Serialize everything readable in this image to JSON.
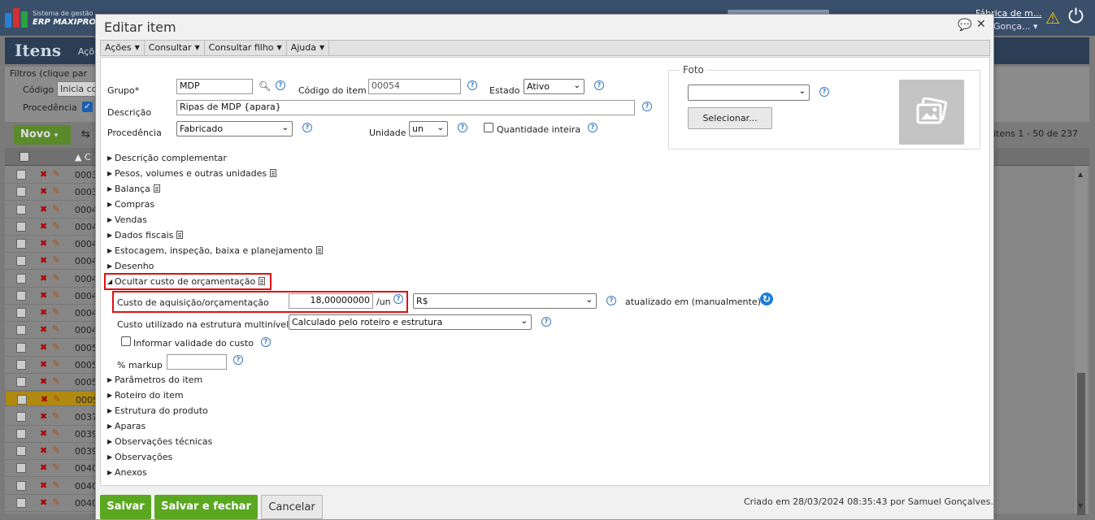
{
  "app": {
    "brand_line1": "Sistema de gestão",
    "brand_line2": "ERP MAXIPROD",
    "company": "Fábrica de m...",
    "user": "Gonça...",
    "page_title": "Itens",
    "page_menu": "Açõ",
    "filters_title": "Filtros (clique par",
    "filter_code_label": "Código",
    "filter_code_value": "Inicia co",
    "filter_origin_label": "Procedência",
    "new_button": "Novo",
    "pager": "itens 1 - 50 de 237",
    "grid_head": "C",
    "rows": [
      "0003",
      "0003",
      "0004",
      "0004",
      "0004",
      "0004",
      "0004",
      "0004",
      "0004",
      "0004",
      "0005",
      "0005",
      "0005",
      "0005",
      "0037",
      "0039",
      "0039",
      "0040",
      "0040",
      "0040"
    ],
    "selected_row": 13
  },
  "modal": {
    "title": "Editar item",
    "menu": [
      "Ações",
      "Consultar",
      "Consultar filho",
      "Ajuda"
    ],
    "form": {
      "grupo_label": "Grupo*",
      "grupo_value": "MDP",
      "codigo_label": "Código do item",
      "codigo_value": "00054",
      "estado_label": "Estado",
      "estado_value": "Ativo",
      "descricao_label": "Descrição",
      "descricao_value": "Ripas de MDP {apara}",
      "procedencia_label": "Procedência",
      "procedencia_value": "Fabricado",
      "unidade_label": "Unidade",
      "unidade_value": "un",
      "qtd_inteira_label": "Quantidade inteira"
    },
    "foto": {
      "legend": "Foto",
      "select_value": "",
      "select_button": "Selecionar..."
    },
    "sections_top": [
      {
        "label": "Descrição complementar",
        "doc": false
      },
      {
        "label": "Pesos, volumes e outras unidades",
        "doc": true
      },
      {
        "label": "Balança",
        "doc": true
      },
      {
        "label": "Compras",
        "doc": false
      },
      {
        "label": "Vendas",
        "doc": false
      },
      {
        "label": "Dados fiscais",
        "doc": true
      },
      {
        "label": "Estocagem, inspeção, baixa e planejamento",
        "doc": true
      },
      {
        "label": "Desenho",
        "doc": false
      }
    ],
    "cost_section": {
      "label": "Ocultar custo de orçamentação",
      "custo_label": "Custo de aquisição/orçamentação",
      "custo_value": "18,00000000",
      "custo_unit": "/un",
      "moeda_value": "R$",
      "atualizado": "atualizado em (manualmente)",
      "estrutura_label": "Custo utilizado na estrutura multinível",
      "estrutura_value": "Calculado pelo roteiro e estrutura",
      "validade_label": "Informar validade do custo",
      "markup_label": "% markup",
      "markup_value": ""
    },
    "sections_bottom": [
      "Parâmetros do item",
      "Roteiro do item",
      "Estrutura do produto",
      "Aparas",
      "Observações técnicas",
      "Observações",
      "Anexos"
    ],
    "footer": {
      "save": "Salvar",
      "save_close": "Salvar e fechar",
      "cancel": "Cancelar",
      "created": "Criado em 28/03/2024 08:35:43 por Samuel Gonçalves."
    }
  },
  "colors": {
    "accent_green": "#5aa820",
    "highlight_red": "#e01010",
    "refresh_blue": "#1c7fd6",
    "help_blue": "#3b7bbf"
  }
}
